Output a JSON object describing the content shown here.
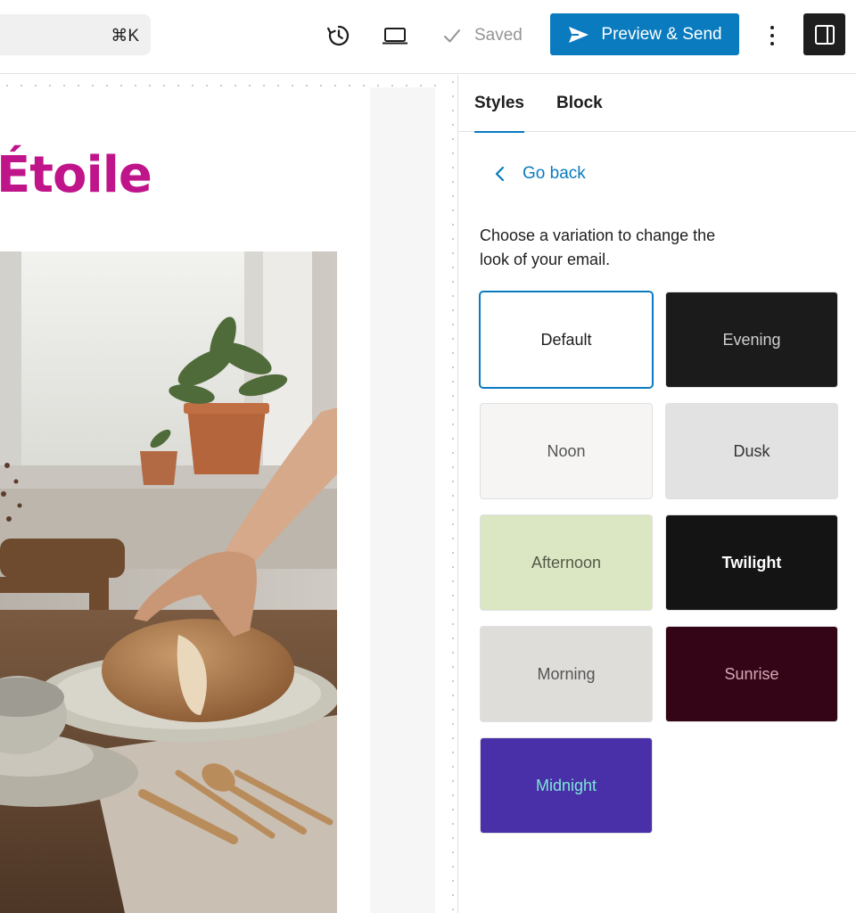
{
  "toolbar": {
    "command_shortcut": "⌘K",
    "saved_label": "Saved",
    "preview_send_label": "Preview & Send"
  },
  "canvas": {
    "brand_text": "Étoile"
  },
  "sidebar": {
    "tabs": [
      {
        "label": "Styles",
        "active": true
      },
      {
        "label": "Block",
        "active": false
      }
    ],
    "go_back_label": "Go back",
    "description": "Choose a variation to change the look of your email.",
    "variations": [
      {
        "label": "Default",
        "bg": "#ffffff",
        "fg": "#1e1e1e",
        "selected": true
      },
      {
        "label": "Evening",
        "bg": "#1b1b1b",
        "fg": "#cfcfcf",
        "selected": false
      },
      {
        "label": "Noon",
        "bg": "#f6f5f4",
        "fg": "#555555",
        "selected": false
      },
      {
        "label": "Dusk",
        "bg": "#e2e2e2",
        "fg": "#333333",
        "selected": false
      },
      {
        "label": "Afternoon",
        "bg": "#dbe6c2",
        "fg": "#555a4a",
        "selected": false
      },
      {
        "label": "Twilight",
        "bg": "#141414",
        "fg": "#ffffff",
        "selected": false
      },
      {
        "label": "Morning",
        "bg": "#dfddda",
        "fg": "#555555",
        "selected": false
      },
      {
        "label": "Sunrise",
        "bg": "#330516",
        "fg": "#d8a7b6",
        "selected": false
      },
      {
        "label": "Midnight",
        "bg": "#4a30a8",
        "fg": "#7de8d6",
        "selected": false
      }
    ]
  },
  "colors": {
    "accent": "#0a7bbf",
    "brand": "#c0148a"
  }
}
